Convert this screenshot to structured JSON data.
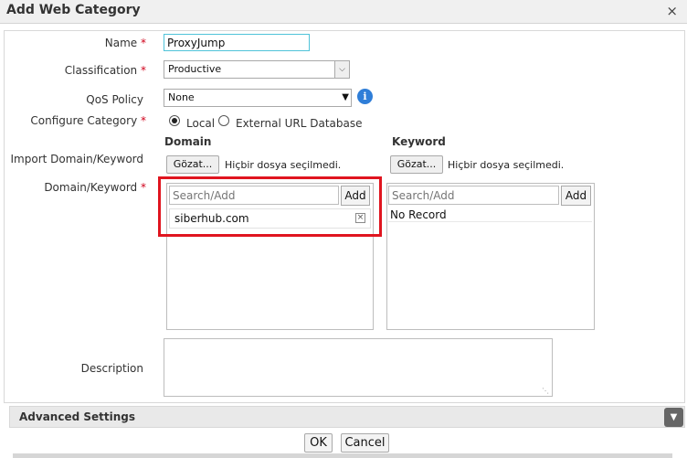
{
  "dialog": {
    "title": "Add Web Category",
    "close_glyph": "×"
  },
  "form": {
    "name": {
      "label": "Name",
      "required_mark": "*",
      "value": "ProxyJump"
    },
    "classification": {
      "label": "Classification",
      "required_mark": "*",
      "selected": "Productive"
    },
    "qos": {
      "label": "QoS Policy",
      "selected": "None",
      "info_icon": "info-icon",
      "info_glyph": "i"
    },
    "configure": {
      "label": "Configure Category",
      "required_mark": "*",
      "options": [
        "Local",
        "External URL Database"
      ],
      "selected": "Local"
    },
    "import_label": "Import Domain/Keyword",
    "domain_keyword": {
      "label": "Domain/Keyword",
      "required_mark": "*"
    },
    "description_label": "Description"
  },
  "domain": {
    "header": "Domain",
    "browse_label": "Gözat...",
    "no_file_text": "Hiçbir dosya seçilmedi.",
    "search_placeholder": "Search/Add",
    "add_label": "Add",
    "items": [
      "siberhub.com"
    ],
    "remove_glyph": "×"
  },
  "keyword": {
    "header": "Keyword",
    "browse_label": "Gözat...",
    "no_file_text": "Hiçbir dosya seçilmedi.",
    "search_placeholder": "Search/Add",
    "add_label": "Add",
    "empty_text": "No Record"
  },
  "advanced": {
    "label": "Advanced Settings",
    "chevron_icon": "chevron-down-icon"
  },
  "footer": {
    "ok_label": "OK",
    "cancel_label": "Cancel"
  },
  "colors": {
    "required": "#d0021b",
    "highlight": "#e0151f",
    "focus_border": "#4fc3d9",
    "info_blue": "#2f7ed8"
  }
}
